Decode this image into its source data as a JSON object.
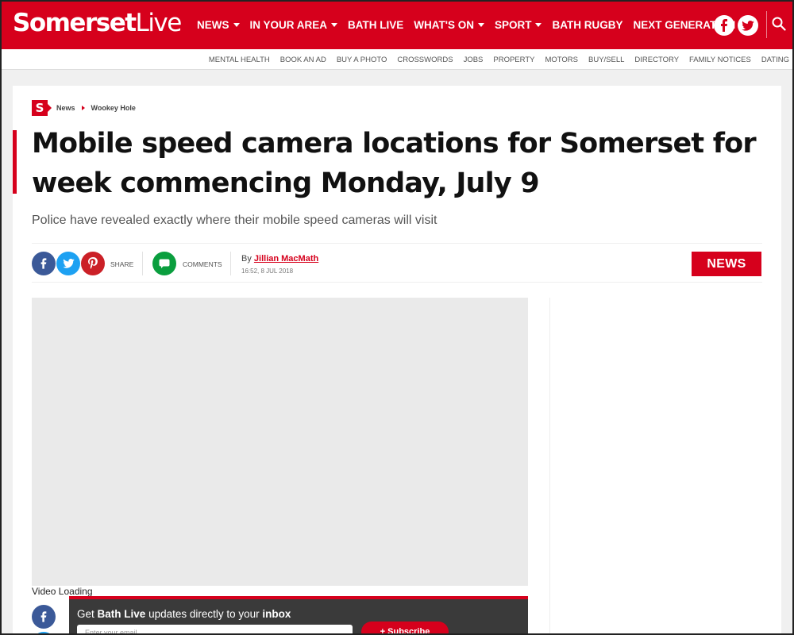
{
  "header": {
    "logo_part1": "Somerset",
    "logo_part2": "Live",
    "nav": [
      {
        "label": "NEWS",
        "has_dropdown": true
      },
      {
        "label": "IN YOUR AREA",
        "has_dropdown": true
      },
      {
        "label": "BATH LIVE",
        "has_dropdown": false
      },
      {
        "label": "WHAT'S ON",
        "has_dropdown": true
      },
      {
        "label": "SPORT",
        "has_dropdown": true
      },
      {
        "label": "BATH RUGBY",
        "has_dropdown": false
      },
      {
        "label": "NEXT GENERATION",
        "has_dropdown": false
      }
    ],
    "icons": [
      "facebook-icon",
      "twitter-icon",
      "search-icon"
    ]
  },
  "subnav": {
    "items": [
      "MENTAL HEALTH",
      "BOOK AN AD",
      "BUY A PHOTO",
      "CROSSWORDS",
      "JOBS",
      "PROPERTY",
      "MOTORS",
      "BUY/SELL",
      "DIRECTORY",
      "FAMILY NOTICES",
      "DATING"
    ]
  },
  "breadcrumb": {
    "logo_letter": "S",
    "items": [
      "News",
      "Wookey Hole"
    ]
  },
  "article": {
    "headline": "Mobile speed camera locations for Somerset for week commencing Monday, July 9",
    "standfirst": "Police have revealed exactly where their mobile speed cameras will visit",
    "share_label": "SHARE",
    "comments_label": "COMMENTS",
    "by_prefix": "By",
    "author": "Jillian MacMath",
    "timestamp": "16:52, 8 JUL 2018",
    "category_badge": "NEWS",
    "video_loading": "Video Loading"
  },
  "newsletter": {
    "text_pre": "Get",
    "brand": "Bath Live",
    "text_mid": "updates directly to your",
    "text_end": "inbox",
    "placeholder": "Enter your email",
    "button_label": "+ Subscribe"
  },
  "colors": {
    "brand_red": "#d6001c",
    "facebook": "#3b5998",
    "twitter": "#1da1f2",
    "pinterest": "#cb2027",
    "comments_green": "#0a9e3e"
  }
}
